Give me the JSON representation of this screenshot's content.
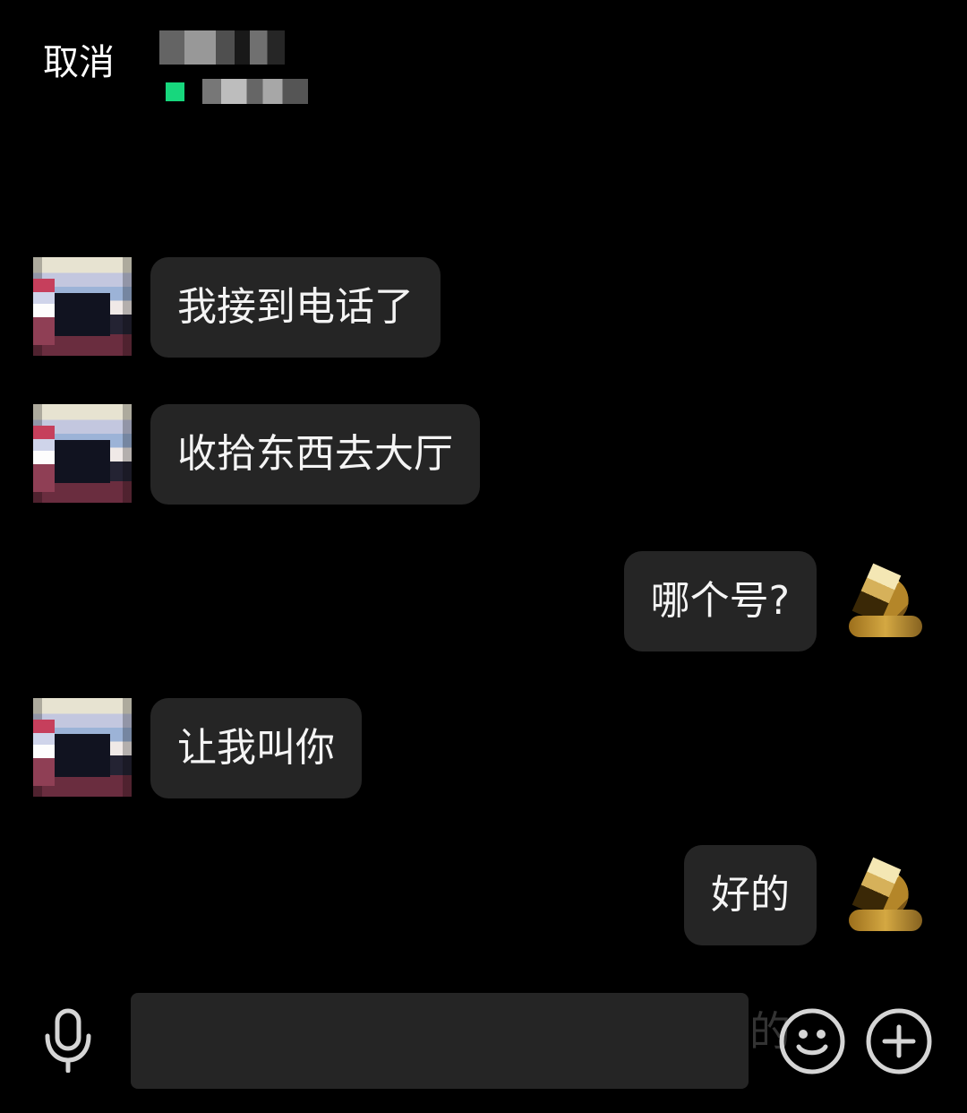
{
  "header": {
    "cancel_label": "取消"
  },
  "messages": [
    {
      "side": "left",
      "text": "我接到电话了"
    },
    {
      "side": "left",
      "text": "收拾东西去大厅"
    },
    {
      "side": "right",
      "text": "哪个号?"
    },
    {
      "side": "left",
      "text": "让我叫你"
    },
    {
      "side": "right",
      "text": "好的"
    }
  ],
  "input": {
    "value": "",
    "placeholder": "",
    "ghost_text": "的"
  },
  "colors": {
    "background": "#000000",
    "bubble": "#252525",
    "status_online": "#17d77d",
    "text": "#ffffff",
    "icon": "#d5d5d5"
  },
  "icons": {
    "voice": "microphone-icon",
    "emoji": "smile-icon",
    "more": "plus-icon"
  }
}
